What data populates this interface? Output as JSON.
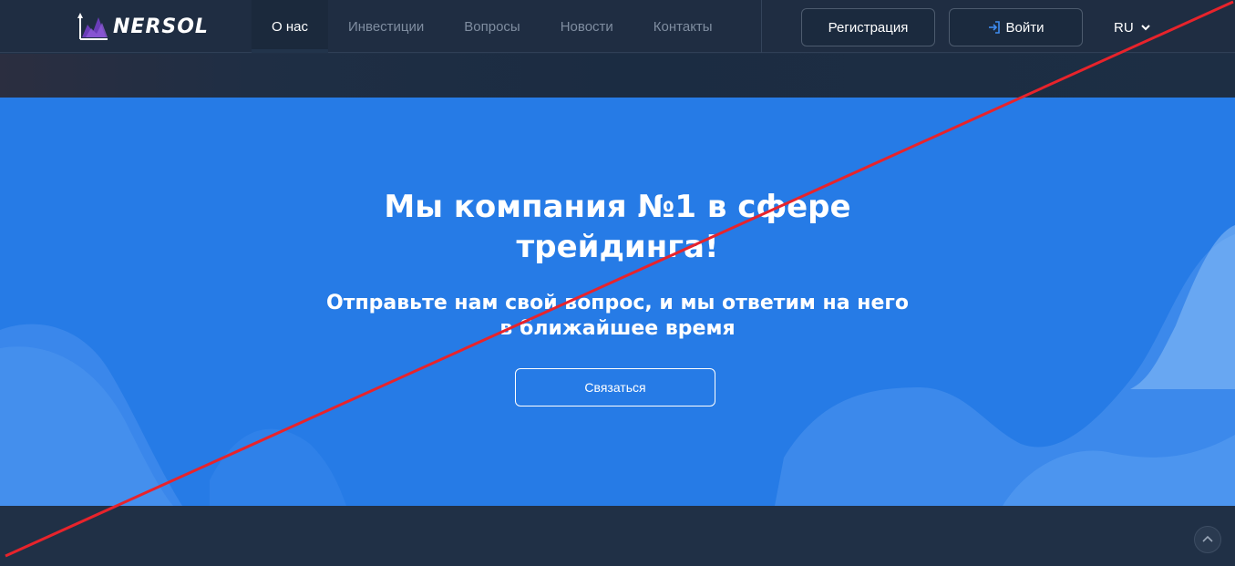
{
  "brand": {
    "name": "NERSOL"
  },
  "nav": {
    "items": [
      {
        "label": "О нас",
        "active": true
      },
      {
        "label": "Инвестиции",
        "active": false
      },
      {
        "label": "Вопросы",
        "active": false
      },
      {
        "label": "Новости",
        "active": false
      },
      {
        "label": "Контакты",
        "active": false
      }
    ]
  },
  "header": {
    "register_label": "Регистрация",
    "login_label": "Войти",
    "login_icon": "login-icon",
    "language": "RU",
    "language_icon": "chevron-down-icon"
  },
  "hero": {
    "title_line1": "Мы компания №1 в сфере",
    "title_line2": "трейдинга!",
    "subtitle_line1": "Отправьте нам свой вопрос, и мы ответим на него",
    "subtitle_line2": "в ближайшее время",
    "cta_label": "Связаться"
  },
  "overlay": {
    "cross_color": "#e8232b"
  },
  "colors": {
    "hero_bg": "#267be6",
    "header_bg": "#1f2d42",
    "accent": "#3f8cf0"
  },
  "scroll_top": {
    "icon": "chevron-up-icon"
  }
}
